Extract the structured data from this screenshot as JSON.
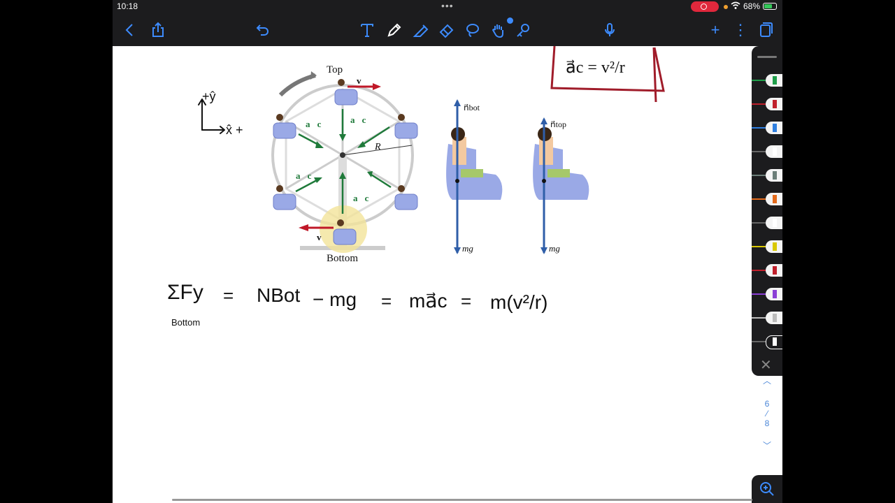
{
  "status": {
    "time": "10:18",
    "battery": "68%",
    "battery_level": 0.68
  },
  "toolbar": {
    "back": "back-icon",
    "share": "share-icon",
    "undo": "undo-icon",
    "text_tool": "T",
    "tools": [
      "pen-icon",
      "highlighter-icon",
      "eraser-icon",
      "lasso-icon",
      "hand-icon",
      "shapes-icon"
    ],
    "mic": "microphone-icon",
    "add": "+",
    "more": "⋮",
    "pages": "pages-icon",
    "accent": "#3d8bfd"
  },
  "handwriting": {
    "formula_box": "a⃗c = v²/r",
    "axes": {
      "y": "+ŷ",
      "x": "x̂ +"
    },
    "equation_left": "ΣFy",
    "equation_sub": "Bottom",
    "equation": [
      "=",
      "NBot",
      "− mg",
      "=",
      "ma⃗c",
      "=",
      "m(v²/r)"
    ]
  },
  "diagram": {
    "top_label": "Top",
    "bottom_label": "Bottom",
    "v_label": "v⃗",
    "ac_label": "a⃗c",
    "r_label": "R",
    "n_bot": "n⃗bot",
    "n_top": "n⃗top",
    "mg": "mg⃗"
  },
  "palette": {
    "colors": [
      "#1f9e4a",
      "#c0202c",
      "#2f7fe0",
      "#ffffff",
      "#6b7e78",
      "#e36a1c",
      "#ffffff",
      "#d9c800",
      "#c0202c",
      "#8b3fd6",
      "#bbbbbb",
      "#ffffff"
    ],
    "close": "✕"
  },
  "pager": {
    "current": "6",
    "sep": "⁄",
    "total": "8"
  }
}
